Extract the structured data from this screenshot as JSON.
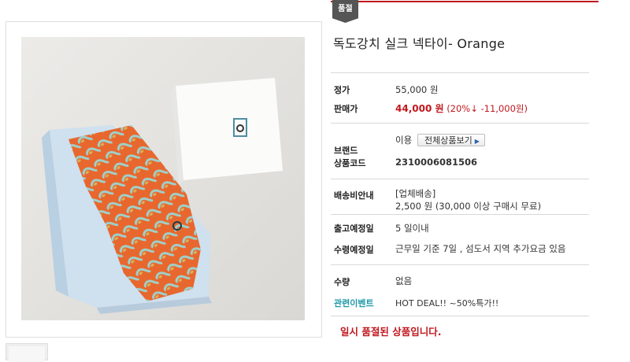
{
  "badge": "품절",
  "product": {
    "title": "독도강치 실크 넥타이- Orange"
  },
  "info": {
    "list_price_label": "정가",
    "list_price": "55,000 원",
    "sale_price_label": "판매가",
    "sale_price": "44,000 원",
    "discount": "(20%↓ -11,000원)",
    "brand_label": "브랜드",
    "brand": "이용",
    "see_all_button": "전체상품보기",
    "product_code_label": "상품코드",
    "product_code": "2310006081506",
    "shipping_label": "배송비안내",
    "shipping_type": "[업체배송]",
    "shipping_fee": "2,500 원 (30,000 이상 구매시 무료)",
    "ship_date_label": "출고예정일",
    "ship_date": "5 일이내",
    "arrival_label": "수령예정일",
    "arrival": "근무일 기준 7일 , 섬도서 지역 추가요금 있음",
    "quantity_label": "수량",
    "quantity": "없음",
    "event_label": "관련이벤트",
    "event": "HOT DEAL!! ~50%특가!!"
  },
  "soldout_message": "일시 품절된 상품입니다.",
  "colors": {
    "accent_red": "#c0181f",
    "event_teal": "#1d9aa8",
    "tie_orange": "#e8672e"
  }
}
